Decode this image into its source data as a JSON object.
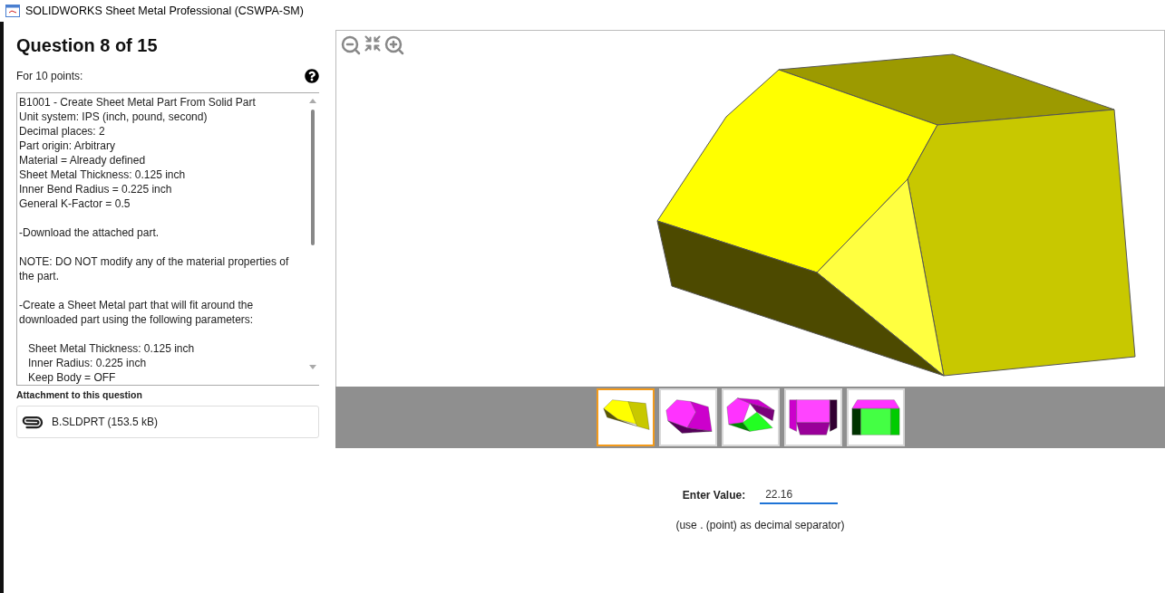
{
  "window": {
    "title": "SOLIDWORKS Sheet Metal Professional (CSWPA-SM)"
  },
  "question": {
    "heading": "Question 8 of 15",
    "points": "For 10 points:"
  },
  "description": [
    {
      "kind": "plain",
      "lines": [
        "B1001 - Create Sheet Metal Part From Solid Part",
        "Unit system: IPS (inch, pound, second)",
        "Decimal places: 2",
        "Part origin: Arbitrary",
        "Material = Already defined",
        "Sheet Metal Thickness: 0.125 inch",
        "Inner Bend Radius = 0.225 inch",
        "General K-Factor = 0.5"
      ]
    },
    {
      "kind": "plain",
      "lines": [
        "-Download the attached part."
      ]
    },
    {
      "kind": "plain",
      "lines": [
        "NOTE: DO NOT modify any of the material properties of the part."
      ]
    },
    {
      "kind": "plain",
      "lines": [
        "-Create a Sheet Metal part that will fit around the downloaded part using the following parameters:"
      ]
    },
    {
      "kind": "indented",
      "lines": [
        "Sheet Metal Thickness: 0.125 inch",
        "Inner Radius: 0.225 inch",
        "Keep Body = OFF"
      ]
    }
  ],
  "attachment": {
    "heading": "Attachment to this question",
    "file": "B.SLDPRT (153.5 kB)"
  },
  "thumbnails": [
    {
      "selected": true
    },
    {
      "selected": false
    },
    {
      "selected": false
    },
    {
      "selected": false
    },
    {
      "selected": false
    }
  ],
  "answer": {
    "label": "Enter Value:",
    "value": "22.16",
    "hint": "(use . (point) as decimal separator)"
  }
}
